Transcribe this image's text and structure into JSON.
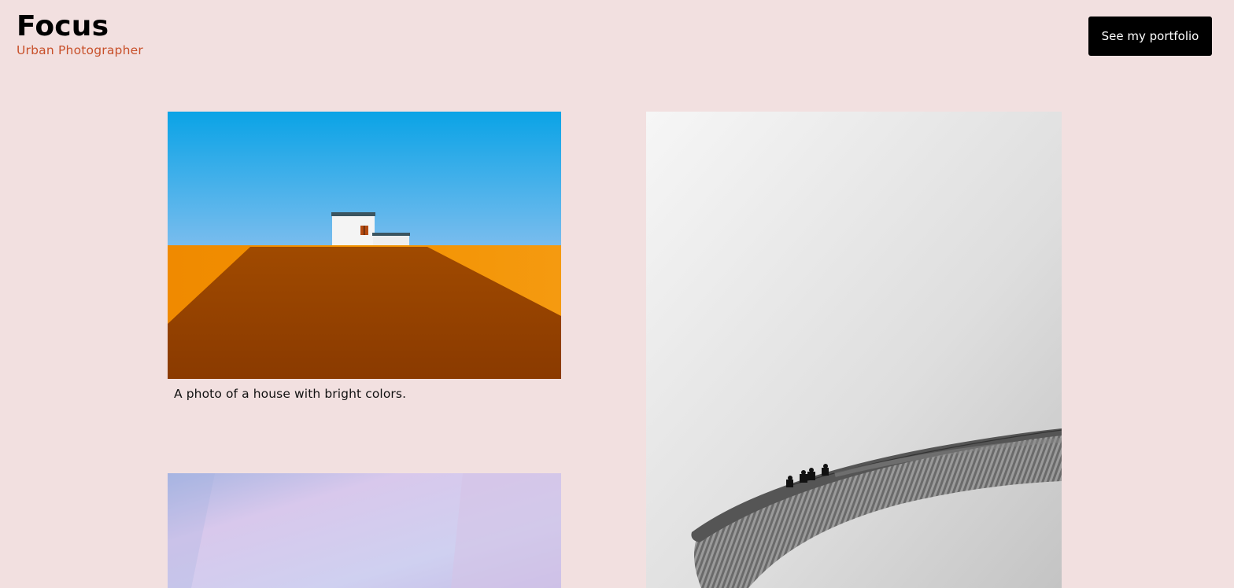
{
  "header": {
    "title": "Focus",
    "subtitle": "Urban Photographer",
    "cta_label": "See my portfolio"
  },
  "gallery": {
    "items": [
      {
        "caption": "A photo of a house with bright colors."
      },
      {
        "caption": ""
      },
      {
        "caption": ""
      }
    ]
  },
  "colors": {
    "background": "#f2e0e0",
    "subtitle": "#c8502a",
    "button": "#000000",
    "button_text": "#ffffff"
  }
}
